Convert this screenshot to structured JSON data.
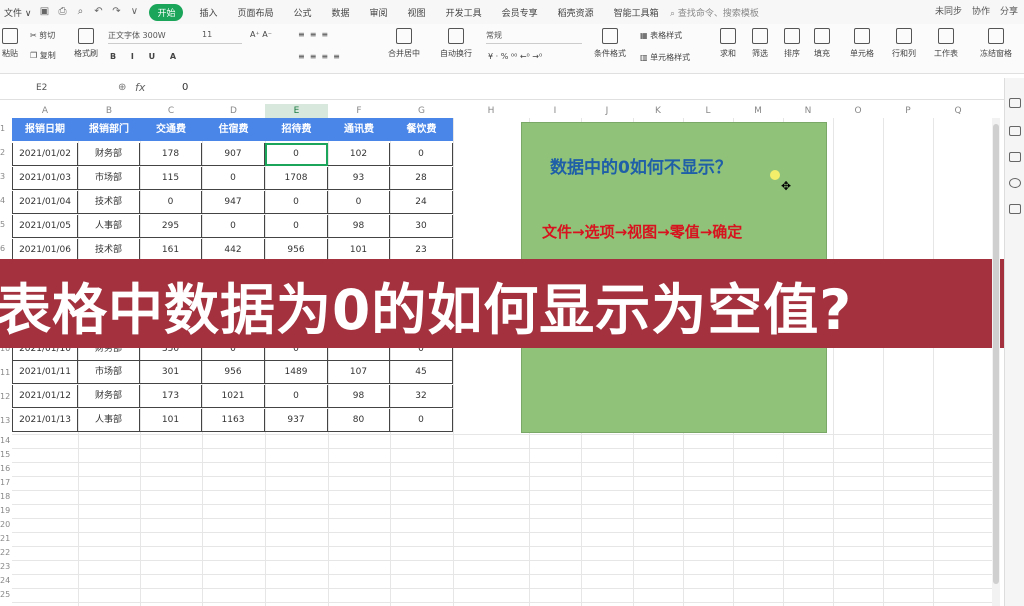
{
  "menubar": {
    "file_label": "文件 ∨",
    "tabs": [
      "开始",
      "插入",
      "页面布局",
      "公式",
      "数据",
      "审阅",
      "视图",
      "开发工具",
      "会员专享",
      "稻壳资源",
      "智能工具箱"
    ],
    "active_tab": "开始",
    "search_placeholder": "查找命令、搜索模板",
    "right_items": [
      "未同步",
      "协作",
      "分享"
    ]
  },
  "ribbon": {
    "font_name": "正文字体 300W",
    "font_size": "11",
    "number_format": "常规",
    "labels": {
      "paste": "粘贴",
      "cut": "剪切",
      "copy": "复制",
      "format_painter": "格式刷",
      "merge": "合并居中",
      "wrap": "自动换行",
      "conditional": "条件格式",
      "table_style": "表格样式",
      "cell_style": "单元格样式",
      "sum": "求和",
      "filter": "筛选",
      "sort": "排序",
      "fill": "填充",
      "cells": "单元格",
      "rowcol": "行和列",
      "sheet": "工作表",
      "freeze": "冻结窗格"
    }
  },
  "formula_bar": {
    "name_box": "E2",
    "fx": "fx",
    "value": "0"
  },
  "columns": [
    "A",
    "B",
    "C",
    "D",
    "E",
    "F",
    "G",
    "H",
    "I",
    "J",
    "K",
    "L",
    "M",
    "N",
    "O",
    "P",
    "Q"
  ],
  "active_column": "E",
  "row_numbers": [
    "1",
    "2",
    "3",
    "4",
    "5",
    "6",
    "7",
    "8",
    "9",
    "10",
    "11",
    "12",
    "13",
    "14",
    "15",
    "16",
    "17",
    "18",
    "19",
    "20",
    "21",
    "22",
    "23",
    "24",
    "25",
    "26",
    "27",
    "28"
  ],
  "table": {
    "headers": [
      "报销日期",
      "报销部门",
      "交通费",
      "住宿费",
      "招待费",
      "通讯费",
      "餐饮费"
    ],
    "rows": [
      [
        "2021/01/02",
        "财务部",
        "178",
        "907",
        "0",
        "102",
        "0"
      ],
      [
        "2021/01/03",
        "市场部",
        "115",
        "0",
        "1708",
        "93",
        "28"
      ],
      [
        "2021/01/04",
        "技术部",
        "0",
        "947",
        "0",
        "0",
        "24"
      ],
      [
        "2021/01/05",
        "人事部",
        "295",
        "0",
        "0",
        "98",
        "30"
      ],
      [
        "2021/01/06",
        "技术部",
        "161",
        "442",
        "956",
        "101",
        "23"
      ],
      [
        "",
        "",
        "",
        "",
        "",
        "",
        ""
      ],
      [
        "",
        "",
        "",
        "",
        "",
        "",
        ""
      ],
      [
        "2021/01/10",
        "财务部",
        "350",
        "0",
        "0",
        "",
        "0"
      ],
      [
        "2021/01/11",
        "市场部",
        "301",
        "956",
        "1489",
        "107",
        "45"
      ],
      [
        "2021/01/12",
        "财务部",
        "173",
        "1021",
        "0",
        "98",
        "32"
      ],
      [
        "2021/01/13",
        "人事部",
        "101",
        "1163",
        "937",
        "80",
        "0"
      ]
    ]
  },
  "note_box": {
    "question": "数据中的0如何不显示？",
    "answer": "文件→选项→视图→零值→确定"
  },
  "banner": {
    "text": "表格中数据为0的如何显示为空值?"
  }
}
